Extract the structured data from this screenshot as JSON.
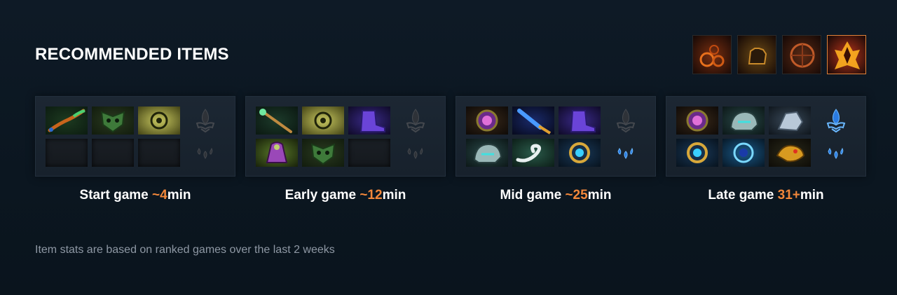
{
  "title": "RECOMMENDED ITEMS",
  "abilities": [
    {
      "name": "ability-1-icon",
      "active": false,
      "color": "#7a2f10"
    },
    {
      "name": "ability-2-icon",
      "active": false,
      "color": "#6b4a16"
    },
    {
      "name": "ability-3-icon",
      "active": false,
      "color": "#5a2a14"
    },
    {
      "name": "ultimate-ability-icon",
      "active": true,
      "color": "#b8341a"
    }
  ],
  "phases": [
    {
      "label": "Start game ",
      "time": "~4",
      "unit": "min",
      "items": [
        {
          "name": "mana-branch-item-icon",
          "kind": "branch"
        },
        {
          "name": "green-mask-item-icon",
          "kind": "mask"
        },
        {
          "name": "yellow-orb-item-icon",
          "kind": "orb"
        },
        {
          "name": "empty-slot",
          "kind": "empty"
        },
        {
          "name": "empty-slot",
          "kind": "empty"
        },
        {
          "name": "empty-slot",
          "kind": "empty"
        }
      ],
      "neutral_top": "dim",
      "neutral_bottom": "dim"
    },
    {
      "label": "Early game ",
      "time": "~12",
      "unit": "min",
      "items": [
        {
          "name": "green-wand-item-icon",
          "kind": "wand"
        },
        {
          "name": "yellow-orb-item-icon",
          "kind": "orb"
        },
        {
          "name": "purple-boots-item-icon",
          "kind": "boots"
        },
        {
          "name": "purple-cloak-item-icon",
          "kind": "cloak"
        },
        {
          "name": "green-mask-item-icon",
          "kind": "mask"
        },
        {
          "name": "empty-slot",
          "kind": "empty"
        }
      ],
      "neutral_top": "dim",
      "neutral_bottom": "dim"
    },
    {
      "label": "Mid game ",
      "time": "~25",
      "unit": "min",
      "items": [
        {
          "name": "pink-gem-item-icon",
          "kind": "gem"
        },
        {
          "name": "blue-staff-item-icon",
          "kind": "staff"
        },
        {
          "name": "purple-boots-item-icon",
          "kind": "boots"
        },
        {
          "name": "silver-helm-item-icon",
          "kind": "helm"
        },
        {
          "name": "white-swirl-item-icon",
          "kind": "swirl"
        },
        {
          "name": "gold-ring-item-icon",
          "kind": "ring"
        }
      ],
      "neutral_top": "dim",
      "neutral_bottom": "blue"
    },
    {
      "label": "Late game ",
      "time": "31+",
      "unit": "min",
      "items": [
        {
          "name": "pink-gem-item-icon",
          "kind": "gem"
        },
        {
          "name": "silver-helm-item-icon",
          "kind": "helm"
        },
        {
          "name": "silver-gauntlet-item-icon",
          "kind": "gauntlet"
        },
        {
          "name": "gold-ring-item-icon",
          "kind": "ring"
        },
        {
          "name": "blue-orb-item-icon",
          "kind": "blueorb"
        },
        {
          "name": "gold-dragon-item-icon",
          "kind": "dragon"
        }
      ],
      "neutral_top": "blue",
      "neutral_bottom": "blue"
    }
  ],
  "footnote": "Item stats are based on ranked games over the last 2 weeks",
  "colors": {
    "accent": "#f2873a",
    "background": "#0e1a26",
    "panel": "#1c2733",
    "muted": "#8e98a4"
  }
}
